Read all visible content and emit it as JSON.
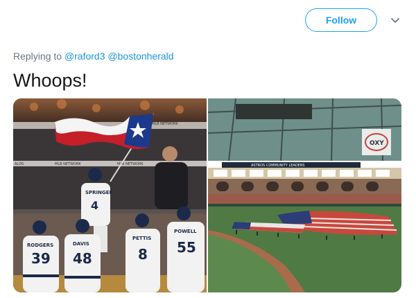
{
  "header": {
    "follow_label": "Follow",
    "more_icon": "chevron-down-icon"
  },
  "reply": {
    "prefix": "Replying to",
    "mentions": [
      "@raford3",
      "@bostonherald"
    ]
  },
  "tweet": {
    "text": "Whoops!"
  },
  "media": {
    "left_photo": {
      "players": [
        {
          "name": "SPRINGER",
          "number": "4"
        },
        {
          "name": "RODGERS",
          "number": "39"
        },
        {
          "name": "DAVIS",
          "number": "48"
        },
        {
          "name": "PETTIS",
          "number": "8"
        },
        {
          "name": "POWELL",
          "number": "55"
        }
      ],
      "dugout_signs": [
        "MLB NETWORK",
        "MLB NETWORK",
        "ALDS",
        "ALDS",
        "MLB NETWORK"
      ]
    },
    "right_photo": {
      "stadium_signs": [
        "OXY",
        "ASTROS COMMUNITY LEADERS"
      ]
    }
  },
  "colors": {
    "accent": "#1da1f2",
    "mention": "#1b95e0",
    "muted": "#657786",
    "text": "#14171a",
    "field_green": "#4f7a44",
    "infield_dirt": "#a86b4c"
  }
}
